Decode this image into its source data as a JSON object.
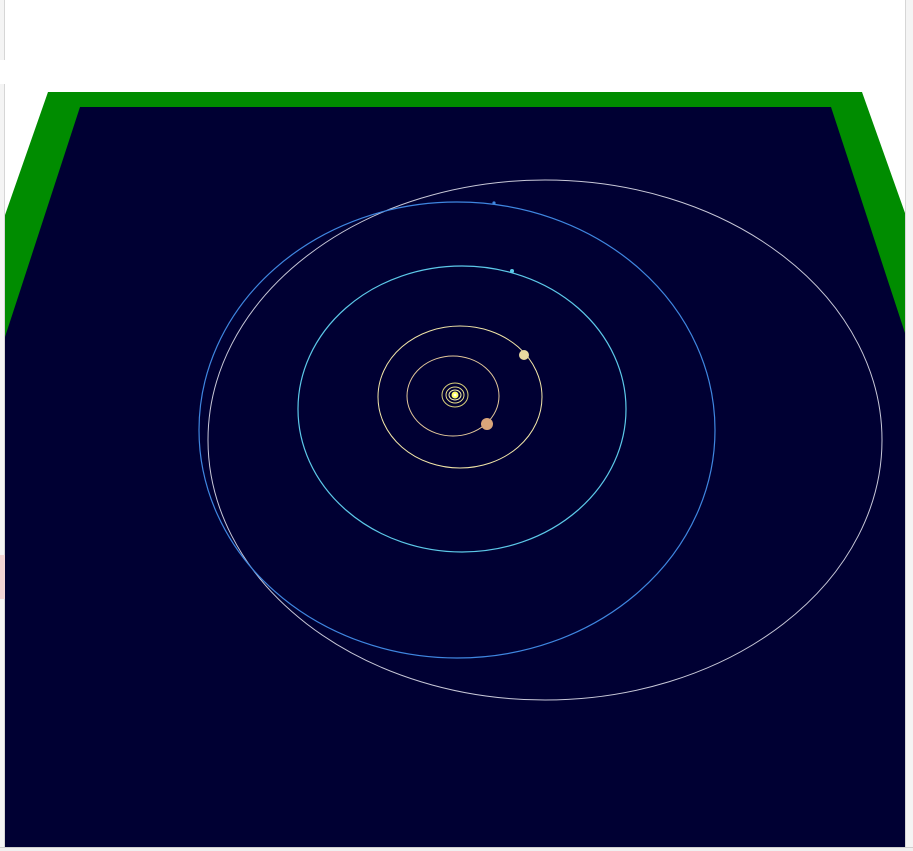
{
  "window": {
    "title": ""
  },
  "scene": {
    "description_free": true,
    "colors": {
      "space": "#000033",
      "grass": "#008c00",
      "background": "#ffffff",
      "sun": "#ffff66",
      "sun_core": "#ffffff"
    },
    "bodies": [
      {
        "name": "inner-orbit-1",
        "orbit_color": "#f5f0b0",
        "planet": false
      },
      {
        "name": "inner-orbit-2",
        "orbit_color": "#e8e08a",
        "planet": false
      },
      {
        "name": "inner-orbit-3",
        "orbit_color": "#d7cf7a",
        "planet": false
      },
      {
        "name": "orbit-4",
        "orbit_color": "#f2e6a8",
        "planet_color": "#e8d9a0"
      },
      {
        "name": "orbit-5",
        "orbit_color": "#e2c79a",
        "planet_color": "#d9a57a"
      },
      {
        "name": "orbit-6",
        "orbit_color": "#5cc8e8",
        "planet_color": "#5cc8e8"
      },
      {
        "name": "orbit-7",
        "orbit_color": "#3f86e0",
        "planet_color": "#3f86e0"
      },
      {
        "name": "orbit-8",
        "orbit_color": "#c8c8d8",
        "planet_color": null
      }
    ]
  }
}
